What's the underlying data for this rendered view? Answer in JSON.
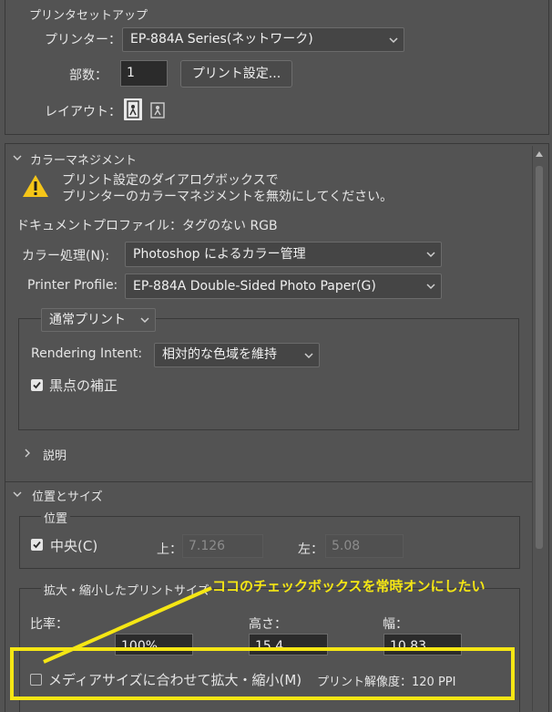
{
  "printer_setup": {
    "title": "プリンタセットアップ",
    "printer_label": "プリンター：",
    "printer_value": "EP-884A  Series(ネットワーク)",
    "copies_label": "部数：",
    "copies_value": "1",
    "print_settings_button": "プリント設定...",
    "layout_label": "レイアウト："
  },
  "color_management": {
    "title": "カラーマネジメント",
    "warning_line1": "プリント設定のダイアログボックスで",
    "warning_line2": "プリンターのカラーマネジメントを無効にしてください。",
    "doc_profile": "ドキュメントプロファイル：タグのない RGB",
    "color_handling_label": "カラー処理(N):",
    "color_handling_value": "Photoshop によるカラー管理",
    "printer_profile_label": "Printer Profile:",
    "printer_profile_value": "EP-884A Double-Sided Photo Paper(G)",
    "print_mode_value": "通常プリント",
    "rendering_intent_label": "Rendering Intent:",
    "rendering_intent_value": "相対的な色域を維持",
    "black_point_label": "黒点の補正",
    "black_point_checked": true,
    "description_label": "説明"
  },
  "position_size": {
    "title": "位置とサイズ",
    "position_group": "位置",
    "center_label": "中央(C)",
    "center_checked": true,
    "top_label": "上：",
    "top_value": "7.126",
    "left_label": "左：",
    "left_value": "5.08",
    "scaled_group": "拡大・縮小したプリントサイズ",
    "scale_label": "比率：",
    "scale_value": "100%",
    "height_label": "高さ：",
    "height_value": "15.4",
    "width_label": "幅：",
    "width_value": "10.83",
    "fit_media_label": "メディアサイズに合わせて拡大・縮小(M)",
    "fit_media_checked": false,
    "resolution_label": "プリント解像度：120 PPI"
  },
  "annotation": {
    "text": "ココのチェックボックスを常時オンにしたい",
    "color": "#f5e614"
  },
  "colors": {
    "panel_bg": "#535353",
    "input_bg": "#2b2b2b",
    "warning_yellow": "#f5c518"
  }
}
